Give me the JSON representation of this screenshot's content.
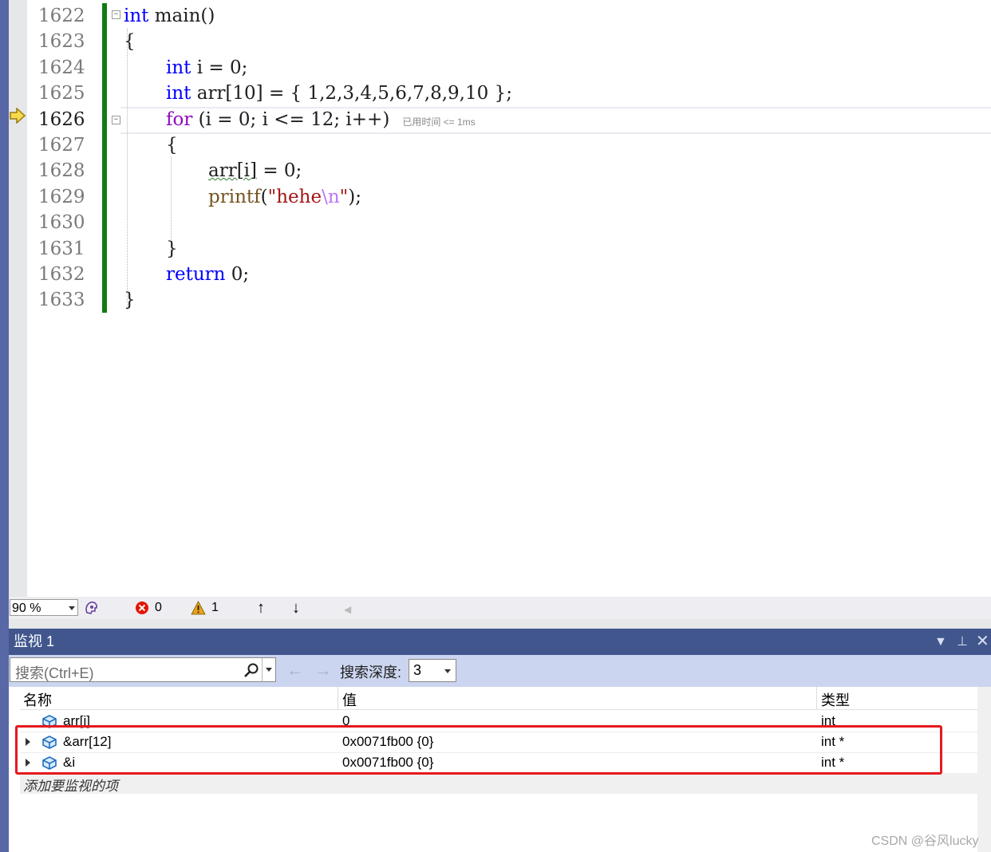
{
  "editor": {
    "lines": [
      {
        "num": "1622"
      },
      {
        "num": "1623"
      },
      {
        "num": "1624"
      },
      {
        "num": "1625"
      },
      {
        "num": "1626"
      },
      {
        "num": "1627"
      },
      {
        "num": "1628"
      },
      {
        "num": "1629"
      },
      {
        "num": "1630"
      },
      {
        "num": "1631"
      },
      {
        "num": "1632"
      },
      {
        "num": "1633"
      }
    ],
    "code": {
      "l1622_kw": "int",
      "l1622_rest": " main()",
      "l1623": "{",
      "l1624_kw": "int",
      "l1624_rest": " i = 0;",
      "l1625_kw": "int",
      "l1625_rest": " arr[10] = { 1,2,3,4,5,6,7,8,9,10 };",
      "l1626_kw": "for",
      "l1626_rest": " (i = 0; i <= 12; i++)",
      "l1626_hint": "已用时间 <= 1ms",
      "l1627": "{",
      "l1628_var": "arr[i]",
      "l1628_rest": " = 0;",
      "l1629_fn": "printf",
      "l1629_open": "(",
      "l1629_str": "\"hehe",
      "l1629_esc": "\\n",
      "l1629_strend": "\"",
      "l1629_close": ");",
      "l1631": "}",
      "l1632_kw": "return",
      "l1632_rest": " 0;",
      "l1633": "}"
    },
    "current_line": "1626"
  },
  "statusbar": {
    "zoom": "90 %",
    "errors": "0",
    "warnings": "1"
  },
  "watch": {
    "title": "监视 1",
    "search_placeholder": "搜索(Ctrl+E)",
    "depth_label": "搜索深度:",
    "depth_value": "3",
    "columns": {
      "name": "名称",
      "value": "值",
      "type": "类型"
    },
    "rows": [
      {
        "name": "arr[i]",
        "value": "0",
        "type": "int"
      },
      {
        "name": "&arr[12]",
        "value": "0x0071fb00 {0}",
        "type": "int *"
      },
      {
        "name": "&i",
        "value": "0x0071fb00 {0}",
        "type": "int *"
      }
    ],
    "add_item": "添加要监视的项"
  },
  "watermark": "CSDN @谷风lucky",
  "colors": {
    "panel_title": "#40568d",
    "highlight": "#e5191e",
    "change_bar": "#107c10"
  }
}
